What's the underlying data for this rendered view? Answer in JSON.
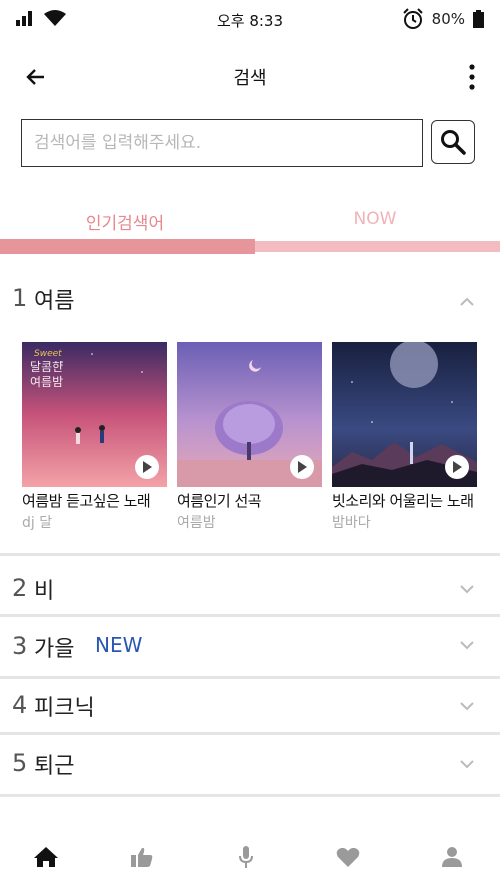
{
  "status": {
    "time": "오후 8:33",
    "battery": "80%"
  },
  "header": {
    "title": "검색"
  },
  "search": {
    "placeholder": "검색어를 입력해주세요."
  },
  "tabs": [
    {
      "label": "인기검색어"
    },
    {
      "label": "NOW"
    }
  ],
  "keywords": [
    {
      "rank": "1",
      "label": "여름"
    },
    {
      "rank": "2",
      "label": "비"
    },
    {
      "rank": "3",
      "label": "가을",
      "badge": "NEW"
    },
    {
      "rank": "4",
      "label": "피크닉"
    },
    {
      "rank": "5",
      "label": "퇴근"
    }
  ],
  "playlists": [
    {
      "title": "여름밤 듣고싶은 노래",
      "curator": "dj 달",
      "cover_text": "달콤한 여름밤",
      "cover_sub": "Sweet"
    },
    {
      "title": "여름인기 선곡",
      "curator": "여름밤"
    },
    {
      "title": "빗소리와 어울리는 노래",
      "curator": "밤바다"
    }
  ],
  "colors": {
    "accent": "#e6959b",
    "accent_light": "#f2bcc0",
    "new_badge": "#2a57b3"
  },
  "icons": {
    "nav": [
      "home-icon",
      "thumbs-up-icon",
      "microphone-icon",
      "heart-icon",
      "person-icon"
    ]
  }
}
